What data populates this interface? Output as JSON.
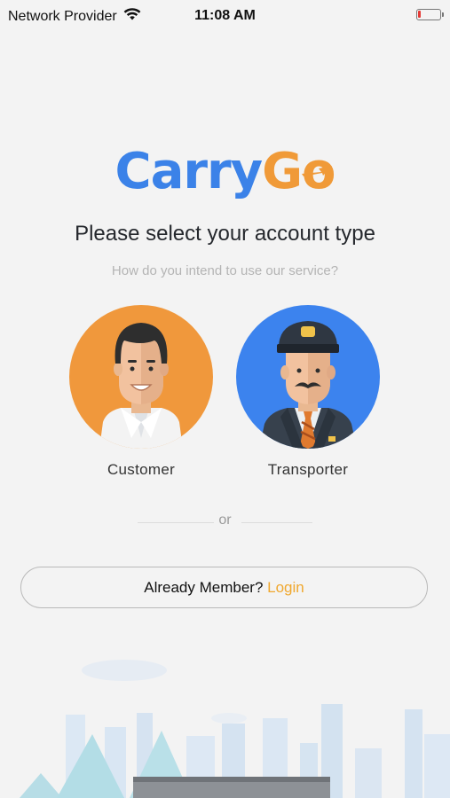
{
  "status_bar": {
    "carrier": "Network Provider",
    "time": "11:08 AM"
  },
  "logo": {
    "part1": "Carry",
    "part2": "Go"
  },
  "heading": {
    "title": "Please select your account type",
    "subtitle": "How do you intend to use our service?"
  },
  "account_types": [
    {
      "label": "Customer",
      "color": "#f0983c"
    },
    {
      "label": "Transporter",
      "color": "#3c83ee"
    }
  ],
  "divider_text": "or",
  "login": {
    "prompt": "Already Member?",
    "link": "Login"
  },
  "colors": {
    "brand_blue": "#3b82e8",
    "brand_orange": "#f09a38",
    "login_link": "#f0a82f"
  }
}
